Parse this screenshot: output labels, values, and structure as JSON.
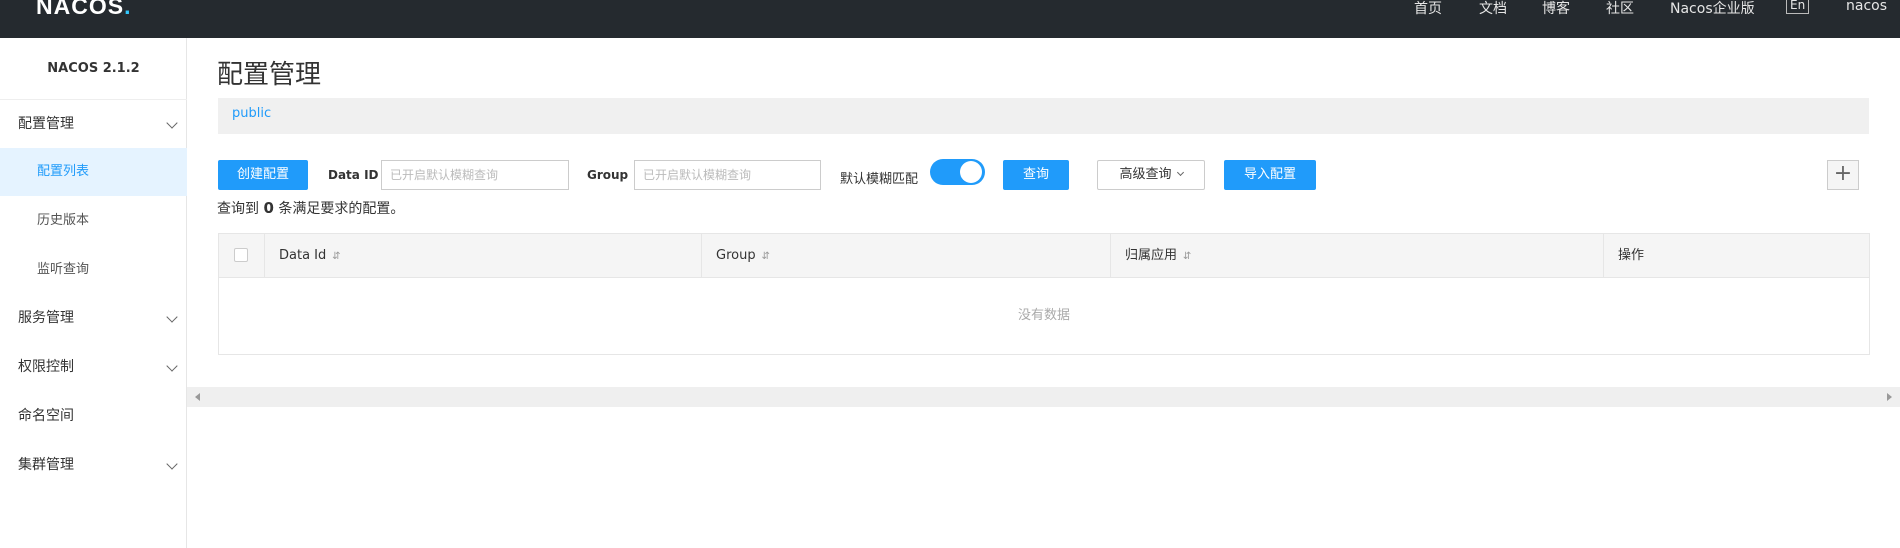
{
  "header": {
    "logo_text": "NACOS",
    "logo_dot": ".",
    "nav": [
      "首页",
      "文档",
      "博客",
      "社区",
      "Nacos企业版"
    ],
    "lang_button": "En",
    "user": "nacos"
  },
  "sidebar": {
    "version": "NACOS 2.1.2",
    "items": [
      {
        "label": "配置管理",
        "expandable": true
      },
      {
        "label": "配置列表",
        "active": true
      },
      {
        "label": "历史版本"
      },
      {
        "label": "监听查询"
      },
      {
        "label": "服务管理",
        "expandable": true
      },
      {
        "label": "权限控制",
        "expandable": true
      },
      {
        "label": "命名空间"
      },
      {
        "label": "集群管理",
        "expandable": true
      }
    ]
  },
  "main": {
    "title": "配置管理",
    "namespace": "public",
    "toolbar": {
      "create_button": "创建配置",
      "dataid_label": "Data ID",
      "dataid_placeholder": "已开启默认模糊查询",
      "group_label": "Group",
      "group_placeholder": "已开启默认模糊查询",
      "fuzzy_label": "默认模糊匹配",
      "fuzzy_enabled": true,
      "query_button": "查询",
      "advanced_button": "高级查询",
      "import_button": "导入配置",
      "add_icon": "plus-icon"
    },
    "result": {
      "prefix": "查询到",
      "count": "0",
      "suffix": "条满足要求的配置。"
    },
    "table": {
      "columns": [
        "Data Id",
        "Group",
        "归属应用",
        "操作"
      ],
      "sort_glyph": "⇵",
      "empty_text": "没有数据"
    }
  },
  "colors": {
    "primary": "#209bfa",
    "header_bg": "#252a2f",
    "active_bg": "#e5f3ff"
  }
}
